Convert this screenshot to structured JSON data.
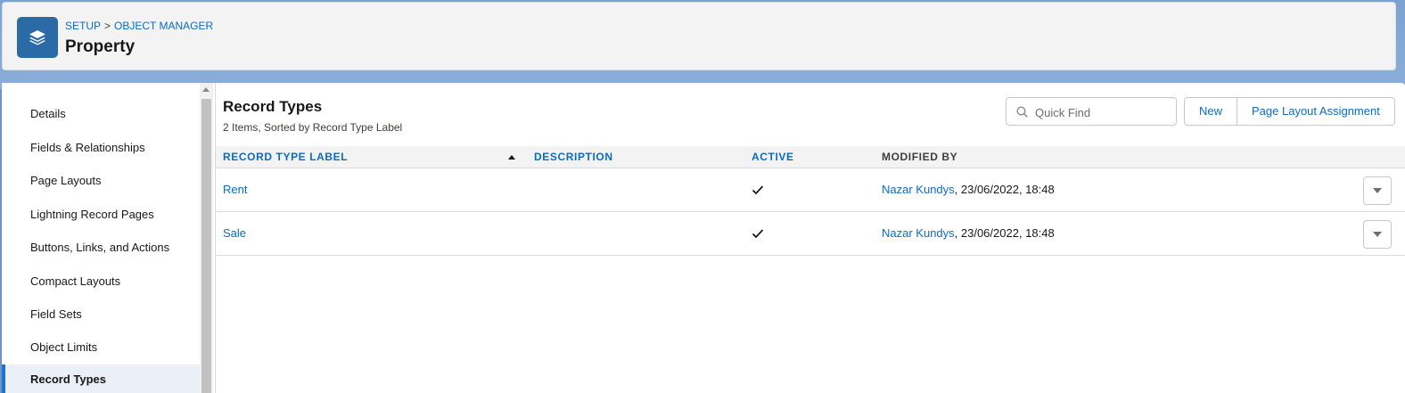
{
  "header": {
    "breadcrumb": [
      "SETUP",
      "OBJECT MANAGER"
    ],
    "breadcrumb_separator": ">",
    "title": "Property",
    "icon": "layers-icon"
  },
  "sidebar": {
    "items": [
      {
        "label": "Details"
      },
      {
        "label": "Fields & Relationships"
      },
      {
        "label": "Page Layouts"
      },
      {
        "label": "Lightning Record Pages"
      },
      {
        "label": "Buttons, Links, and Actions"
      },
      {
        "label": "Compact Layouts"
      },
      {
        "label": "Field Sets"
      },
      {
        "label": "Object Limits"
      },
      {
        "label": "Record Types",
        "active": true
      }
    ]
  },
  "main": {
    "title": "Record Types",
    "subtitle": "2 Items, Sorted by Record Type Label",
    "search": {
      "placeholder": "Quick Find",
      "value": ""
    },
    "buttons": {
      "new": "New",
      "page_layout_assignment": "Page Layout Assignment"
    },
    "table": {
      "columns": [
        "RECORD TYPE LABEL",
        "DESCRIPTION",
        "ACTIVE",
        "MODIFIED BY"
      ],
      "sorted_column": "RECORD TYPE LABEL",
      "sort_direction": "ascending",
      "rows": [
        {
          "label": "Rent",
          "description": "",
          "active": true,
          "modified_by_user": "Nazar Kundys",
          "modified_at": ", 23/06/2022, 18:48"
        },
        {
          "label": "Sale",
          "description": "",
          "active": true,
          "modified_by_user": "Nazar Kundys",
          "modified_at": ", 23/06/2022, 18:48"
        }
      ]
    }
  },
  "colors": {
    "brand_blue": "#0b6cc4",
    "icon_bg": "#2a6aa7",
    "background": "#6f95c4",
    "active_item_bg": "#ebf0f8"
  }
}
